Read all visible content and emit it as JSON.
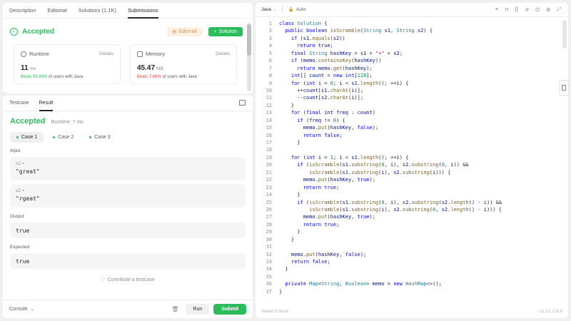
{
  "top_tabs": [
    "Description",
    "Editorial",
    "Solutions (1.1K)",
    "Submissions"
  ],
  "submission": {
    "status": "Accepted",
    "editorial_label": "Editorial",
    "solution_label": "Solution",
    "runtime": {
      "label": "Runtime",
      "details": "Details",
      "value": "11",
      "unit": "ms",
      "beats_pct": "Beats 55.60%",
      "beats_suffix": "of users with Java"
    },
    "memory": {
      "label": "Memory",
      "details": "Details",
      "value": "45.47",
      "unit": "MB",
      "beats_pct": "Beats 7.68%",
      "beats_suffix": "of users with Java"
    }
  },
  "console_tabs": [
    "Testcase",
    "Result"
  ],
  "result": {
    "status": "Accepted",
    "runtime": "Runtime: 7 ms",
    "cases": [
      "Case 1",
      "Case 2",
      "Case 3"
    ],
    "input_label": "Input",
    "inputs": [
      {
        "name": "s1 =",
        "value": "\"great\""
      },
      {
        "name": "s2 =",
        "value": "\"rgeat\""
      }
    ],
    "output_label": "Output",
    "output": "true",
    "expected_label": "Expected",
    "expected": "true",
    "contribute": "Contribute a testcase"
  },
  "footer": {
    "console": "Console",
    "run": "Run",
    "submit": "Submit"
  },
  "editor": {
    "language": "Java",
    "mode": "Auto",
    "saved": "Saved to local",
    "cursor": "Ln 12, Col 6",
    "lines": [
      "class Solution {",
      "  public boolean isScramble(String s1, String s2) {",
      "    if (s1.equals(s2))",
      "      return true;",
      "    final String hashKey = s1 + \"+\" + s2;",
      "    if (memo.containsKey(hashKey))",
      "      return memo.get(hashKey);",
      "    int[] count = new int[128];",
      "    for (int i = 0; i < s1.length(); ++i) {",
      "      ++count[s1.charAt(i)];",
      "      --count[s2.charAt(i)];",
      "    }",
      "    for (final int freq : count)",
      "      if (freq != 0) {",
      "        memo.put(hashKey, false);",
      "        return false;",
      "      }",
      "",
      "    for (int i = 1; i < s1.length(); ++i) {",
      "      if (isScramble(s1.substring(0, i), s2.substring(0, i)) &&",
      "          isScramble(s1.substring(i), s2.substring(i))) {",
      "        memo.put(hashKey, true);",
      "        return true;",
      "      }",
      "      if (isScramble(s1.substring(0, i), s2.substring(s2.length() - i)) &&",
      "          isScramble(s1.substring(i), s2.substring(0, s2.length() - i))) {",
      "        memo.put(hashKey, true);",
      "        return true;",
      "      }",
      "    }",
      "",
      "    memo.put(hashKey, false);",
      "    return false;",
      "  }",
      "",
      "  private Map<String, Boolean> memo = new HashMap<>();",
      "}"
    ]
  },
  "colors": {
    "accent_green": "#2cbb5d",
    "editorial_orange": "#e98e3f",
    "beats_red": "#ef4743"
  }
}
